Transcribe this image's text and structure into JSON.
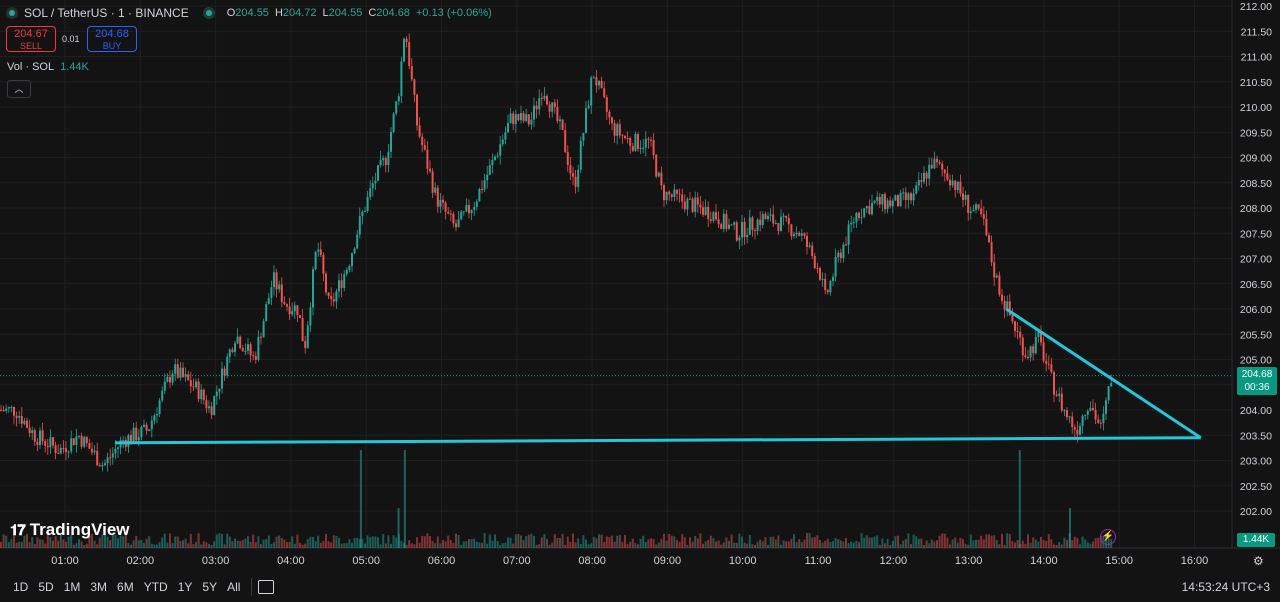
{
  "header": {
    "symbol": "SOL / TetherUS · 1 · BINANCE",
    "o_label": "O",
    "o_value": "204.55",
    "h_label": "H",
    "h_value": "204.72",
    "l_label": "L",
    "l_value": "204.55",
    "c_label": "C",
    "c_value": "204.68",
    "change": "+0.13 (+0.06%)"
  },
  "trade": {
    "sell_price": "204.67",
    "sell_label": "SELL",
    "spread": "0.01",
    "buy_price": "204.68",
    "buy_label": "BUY"
  },
  "volume_indicator": {
    "label": "Vol · SOL",
    "value": "1.44K"
  },
  "brand": "TradingView",
  "price_tag": {
    "price": "204.68",
    "countdown": "00:36"
  },
  "volume_tag": "1.44K",
  "bottom_bar": {
    "ranges": [
      "1D",
      "5D",
      "1M",
      "3M",
      "6M",
      "YTD",
      "1Y",
      "5Y",
      "All"
    ],
    "clock": "14:53:24 UTC+3"
  },
  "colors": {
    "background": "#131313",
    "up": "#26a69a",
    "down": "#ef5350",
    "trendline": "#26c6da",
    "grid": "#1f1f1f",
    "price_tag": "#089981"
  },
  "chart_data": {
    "type": "candlestick",
    "symbol": "SOL/USDT",
    "ylim": [
      201.5,
      212.0
    ],
    "y_ticks": [
      "212.00",
      "211.50",
      "211.00",
      "210.50",
      "210.00",
      "209.50",
      "209.00",
      "208.50",
      "208.00",
      "207.50",
      "207.00",
      "206.50",
      "206.00",
      "205.50",
      "205.00",
      "204.50",
      "204.00",
      "203.50",
      "203.00",
      "202.50",
      "202.00"
    ],
    "x_ticks": [
      "01:00",
      "02:00",
      "03:00",
      "04:00",
      "05:00",
      "06:00",
      "07:00",
      "08:00",
      "09:00",
      "10:00",
      "11:00",
      "12:00",
      "13:00",
      "14:00",
      "15:00",
      "16:00"
    ],
    "price_path": [
      {
        "t": "00:20",
        "p": 204.0
      },
      {
        "t": "00:35",
        "p": 203.5
      },
      {
        "t": "00:55",
        "p": 203.2
      },
      {
        "t": "01:10",
        "p": 203.5
      },
      {
        "t": "01:30",
        "p": 202.9
      },
      {
        "t": "01:45",
        "p": 203.4
      },
      {
        "t": "02:05",
        "p": 203.6
      },
      {
        "t": "02:25",
        "p": 204.8
      },
      {
        "t": "02:45",
        "p": 204.4
      },
      {
        "t": "02:55",
        "p": 204.0
      },
      {
        "t": "03:15",
        "p": 205.5
      },
      {
        "t": "03:30",
        "p": 205.0
      },
      {
        "t": "03:45",
        "p": 206.6
      },
      {
        "t": "03:55",
        "p": 206.1
      },
      {
        "t": "04:05",
        "p": 206.0
      },
      {
        "t": "04:10",
        "p": 205.2
      },
      {
        "t": "04:20",
        "p": 207.3
      },
      {
        "t": "04:30",
        "p": 206.0
      },
      {
        "t": "04:45",
        "p": 206.9
      },
      {
        "t": "04:55",
        "p": 207.8
      },
      {
        "t": "05:05",
        "p": 208.5
      },
      {
        "t": "05:15",
        "p": 209.0
      },
      {
        "t": "05:25",
        "p": 210.3
      },
      {
        "t": "05:30",
        "p": 211.6
      },
      {
        "t": "05:40",
        "p": 209.6
      },
      {
        "t": "05:55",
        "p": 208.2
      },
      {
        "t": "06:10",
        "p": 207.6
      },
      {
        "t": "06:25",
        "p": 208.1
      },
      {
        "t": "06:40",
        "p": 208.9
      },
      {
        "t": "06:55",
        "p": 209.8
      },
      {
        "t": "07:10",
        "p": 209.7
      },
      {
        "t": "07:20",
        "p": 210.4
      },
      {
        "t": "07:35",
        "p": 209.5
      },
      {
        "t": "07:45",
        "p": 208.4
      },
      {
        "t": "08:00",
        "p": 210.7
      },
      {
        "t": "08:15",
        "p": 209.6
      },
      {
        "t": "08:30",
        "p": 209.3
      },
      {
        "t": "08:45",
        "p": 209.3
      },
      {
        "t": "08:55",
        "p": 208.3
      },
      {
        "t": "09:15",
        "p": 208.1
      },
      {
        "t": "09:35",
        "p": 207.9
      },
      {
        "t": "09:55",
        "p": 207.5
      },
      {
        "t": "10:15",
        "p": 207.8
      },
      {
        "t": "10:30",
        "p": 207.7
      },
      {
        "t": "10:45",
        "p": 207.5
      },
      {
        "t": "11:00",
        "p": 206.8
      },
      {
        "t": "11:05",
        "p": 206.2
      },
      {
        "t": "11:15",
        "p": 207.0
      },
      {
        "t": "11:30",
        "p": 207.9
      },
      {
        "t": "11:45",
        "p": 208.1
      },
      {
        "t": "12:00",
        "p": 208.1
      },
      {
        "t": "12:15",
        "p": 208.2
      },
      {
        "t": "12:30",
        "p": 208.9
      },
      {
        "t": "12:45",
        "p": 208.6
      },
      {
        "t": "13:00",
        "p": 208.0
      },
      {
        "t": "13:10",
        "p": 207.8
      },
      {
        "t": "13:20",
        "p": 206.7
      },
      {
        "t": "13:25",
        "p": 206.3
      },
      {
        "t": "13:35",
        "p": 205.7
      },
      {
        "t": "13:45",
        "p": 205.1
      },
      {
        "t": "13:55",
        "p": 205.4
      },
      {
        "t": "14:05",
        "p": 204.6
      },
      {
        "t": "14:15",
        "p": 204.0
      },
      {
        "t": "14:25",
        "p": 203.6
      },
      {
        "t": "14:35",
        "p": 204.2
      },
      {
        "t": "14:45",
        "p": 203.6
      },
      {
        "t": "14:53",
        "p": 204.68
      }
    ],
    "volume_spikes": [
      {
        "t": "04:55",
        "v": "high"
      },
      {
        "t": "05:30",
        "v": "high"
      },
      {
        "t": "05:25",
        "v": "medium"
      },
      {
        "t": "13:40",
        "v": "high"
      },
      {
        "t": "14:20",
        "v": "medium"
      }
    ],
    "trendlines": [
      {
        "from": {
          "t": "01:40",
          "p": 203.35
        },
        "to": {
          "t": "16:05",
          "p": 203.45
        }
      },
      {
        "from": {
          "t": "13:30",
          "p": 206.0
        },
        "to": {
          "t": "16:05",
          "p": 203.45
        }
      }
    ],
    "last_price": 204.68,
    "grid": true
  }
}
